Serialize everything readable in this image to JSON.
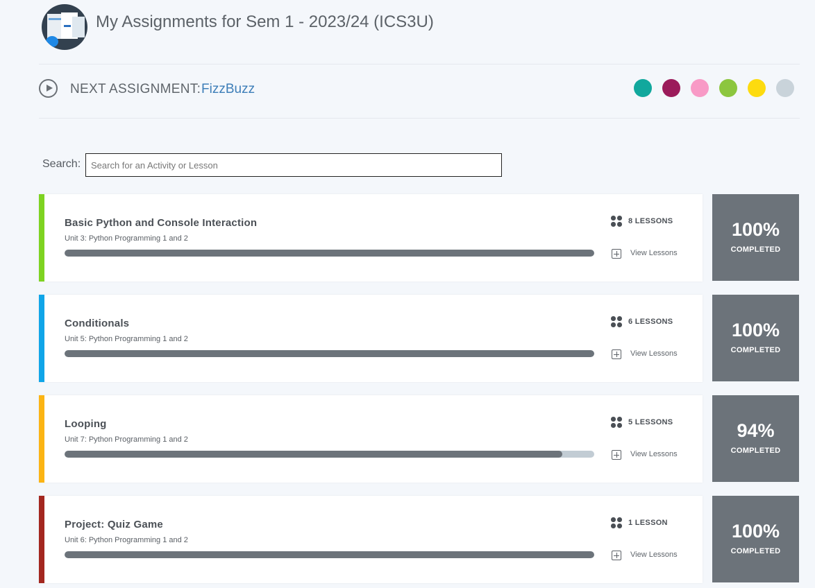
{
  "header": {
    "title": "My Assignments for Sem 1 - 2023/24 (ICS3U)",
    "logo_icon": "course-logo-icon"
  },
  "next_assignment": {
    "label": "NEXT ASSIGNMENT:",
    "link": "FizzBuzz",
    "icon": "play-circle-icon"
  },
  "theme_colors": [
    "#11a89d",
    "#9b1b5a",
    "#f89ac6",
    "#8cc63e",
    "#fddb0f",
    "#c9d3da"
  ],
  "search": {
    "label": "Search:",
    "placeholder": "Search for an Activity or Lesson",
    "value": ""
  },
  "assignments": [
    {
      "title": "Basic Python and Console Interaction",
      "unit": "Unit 3: Python Programming 1 and 2",
      "lessons": "8 LESSONS",
      "view_label": "View Lessons",
      "progress": 1.0,
      "percent": "100%",
      "completed_label": "COMPLETED",
      "accent": "#7ed321"
    },
    {
      "title": "Conditionals",
      "unit": "Unit 5: Python Programming 1 and 2",
      "lessons": "6 LESSONS",
      "view_label": "View Lessons",
      "progress": 1.0,
      "percent": "100%",
      "completed_label": "COMPLETED",
      "accent": "#10a5e8"
    },
    {
      "title": "Looping",
      "unit": "Unit 7: Python Programming 1 and 2",
      "lessons": "5 LESSONS",
      "view_label": "View Lessons",
      "progress": 0.94,
      "percent": "94%",
      "completed_label": "COMPLETED",
      "accent": "#fbb414"
    },
    {
      "title": "Project: Quiz Game",
      "unit": "Unit 6: Python Programming 1 and 2",
      "lessons": "1 LESSON",
      "view_label": "View Lessons",
      "progress": 1.0,
      "percent": "100%",
      "completed_label": "COMPLETED",
      "accent": "#a3271f"
    }
  ]
}
